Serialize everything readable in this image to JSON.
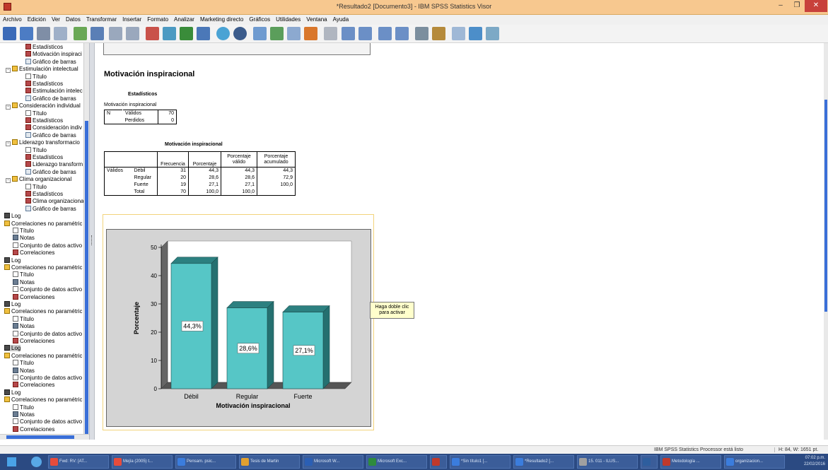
{
  "window": {
    "title": "*Resultado2 [Documento3] - IBM SPSS Statistics Visor"
  },
  "menu": [
    "Archivo",
    "Edición",
    "Ver",
    "Datos",
    "Transformar",
    "Insertar",
    "Formato",
    "Analizar",
    "Marketing directo",
    "Gráficos",
    "Utilidades",
    "Ventana",
    "Ayuda"
  ],
  "outline": [
    {
      "label": "Estadísticos",
      "icon": "statistics-icon",
      "indent": 36
    },
    {
      "label": "Motivación inspiraci",
      "icon": "table-icon",
      "indent": 36
    },
    {
      "label": "Gráfico de barras",
      "icon": "chart-icon",
      "indent": 36
    },
    {
      "label": "Estimulación intelectual",
      "icon": "section-icon",
      "indent": 8,
      "expand": "−"
    },
    {
      "label": "Título",
      "icon": "title-icon",
      "indent": 36
    },
    {
      "label": "Estadísticos",
      "icon": "statistics-icon",
      "indent": 36
    },
    {
      "label": "Estimulación intelec",
      "icon": "table-icon",
      "indent": 36
    },
    {
      "label": "Gráfico de barras",
      "icon": "chart-icon",
      "indent": 36
    },
    {
      "label": "Consideración individual",
      "icon": "section-icon",
      "indent": 8,
      "expand": "−"
    },
    {
      "label": "Título",
      "icon": "title-icon",
      "indent": 36
    },
    {
      "label": "Estadísticos",
      "icon": "statistics-icon",
      "indent": 36
    },
    {
      "label": "Consideración indiv",
      "icon": "table-icon",
      "indent": 36
    },
    {
      "label": "Gráfico de barras",
      "icon": "chart-icon",
      "indent": 36
    },
    {
      "label": "Liderazgo transformacio",
      "icon": "section-icon",
      "indent": 8,
      "expand": "−"
    },
    {
      "label": "Título",
      "icon": "title-icon",
      "indent": 36
    },
    {
      "label": "Estadísticos",
      "icon": "statistics-icon",
      "indent": 36
    },
    {
      "label": "Liderazgo transform",
      "icon": "table-icon",
      "indent": 36
    },
    {
      "label": "Gráfico de barras",
      "icon": "chart-icon",
      "indent": 36
    },
    {
      "label": "Clima organizacional",
      "icon": "section-icon",
      "indent": 8,
      "expand": "−"
    },
    {
      "label": "Título",
      "icon": "title-icon",
      "indent": 36
    },
    {
      "label": "Estadísticos",
      "icon": "statistics-icon",
      "indent": 36
    },
    {
      "label": "Clima organizacional",
      "icon": "table-icon",
      "indent": 36
    },
    {
      "label": "Gráfico de barras",
      "icon": "chart-icon",
      "indent": 36
    },
    {
      "label": "Log",
      "icon": "log-icon",
      "indent": 6
    },
    {
      "label": "Correlaciones no paramétric",
      "icon": "section-icon",
      "indent": 6
    },
    {
      "label": "Título",
      "icon": "title-icon",
      "indent": 18
    },
    {
      "label": "Notas",
      "icon": "notes-icon",
      "indent": 18
    },
    {
      "label": "Conjunto de datos activo",
      "icon": "dataset-icon",
      "indent": 18
    },
    {
      "label": "Correlaciones",
      "icon": "table-icon",
      "indent": 18
    },
    {
      "label": "Log",
      "icon": "log-icon",
      "indent": 6
    },
    {
      "label": "Correlaciones no paramétric",
      "icon": "section-icon",
      "indent": 6
    },
    {
      "label": "Título",
      "icon": "title-icon",
      "indent": 18
    },
    {
      "label": "Notas",
      "icon": "notes-icon",
      "indent": 18
    },
    {
      "label": "Conjunto de datos activo",
      "icon": "dataset-icon",
      "indent": 18
    },
    {
      "label": "Correlaciones",
      "icon": "table-icon",
      "indent": 18
    },
    {
      "label": "Log",
      "icon": "log-icon",
      "indent": 6
    },
    {
      "label": "Correlaciones no paramétric",
      "icon": "section-icon",
      "indent": 6
    },
    {
      "label": "Título",
      "icon": "title-icon",
      "indent": 18
    },
    {
      "label": "Notas",
      "icon": "notes-icon",
      "indent": 18
    },
    {
      "label": "Conjunto de datos activo",
      "icon": "dataset-icon",
      "indent": 18
    },
    {
      "label": "Correlaciones",
      "icon": "table-icon",
      "indent": 18
    },
    {
      "label": "Log",
      "icon": "log-icon",
      "indent": 6,
      "selected": true
    },
    {
      "label": "Correlaciones no paramétric",
      "icon": "section-icon",
      "indent": 6
    },
    {
      "label": "Título",
      "icon": "title-icon",
      "indent": 18
    },
    {
      "label": "Notas",
      "icon": "notes-icon",
      "indent": 18
    },
    {
      "label": "Conjunto de datos activo",
      "icon": "dataset-icon",
      "indent": 18
    },
    {
      "label": "Correlaciones",
      "icon": "table-icon",
      "indent": 18
    },
    {
      "label": "Log",
      "icon": "log-icon",
      "indent": 6
    },
    {
      "label": "Correlaciones no paramétric",
      "icon": "section-icon",
      "indent": 6
    },
    {
      "label": "Título",
      "icon": "title-icon",
      "indent": 18
    },
    {
      "label": "Notas",
      "icon": "notes-icon",
      "indent": 18
    },
    {
      "label": "Conjunto de datos activo",
      "icon": "dataset-icon",
      "indent": 18
    },
    {
      "label": "Correlaciones",
      "icon": "table-icon",
      "indent": 18
    }
  ],
  "content": {
    "heading": "Motivación inspiracional",
    "stats": {
      "title": "Estadísticos",
      "subtitle": "Motivación inspiracional",
      "n_label": "N",
      "valid_label": "Válidos",
      "valid_value": "70",
      "missing_label": "Perdidos",
      "missing_value": "0"
    },
    "freq": {
      "title": "Motivación inspiracional",
      "headers": [
        "Frecuencia",
        "Porcentaje",
        "Porcentaje válido",
        "Porcentaje acumulado"
      ],
      "group_label": "Válidos",
      "rows": [
        {
          "label": "Débil",
          "values": [
            "31",
            "44,3",
            "44,3",
            "44,3"
          ]
        },
        {
          "label": "Regular",
          "values": [
            "20",
            "28,6",
            "28,6",
            "72,9"
          ]
        },
        {
          "label": "Fuerte",
          "values": [
            "19",
            "27,1",
            "27,1",
            "100,0"
          ]
        },
        {
          "label": "Total",
          "values": [
            "70",
            "100,0",
            "100,0",
            ""
          ]
        }
      ]
    },
    "tooltip": "Haga doble clic para activar"
  },
  "chart_data": {
    "type": "bar",
    "categories": [
      "Débil",
      "Regular",
      "Fuerte"
    ],
    "values": [
      44.3,
      28.6,
      27.1
    ],
    "data_labels": [
      "44,3%",
      "28,6%",
      "27,1%"
    ],
    "xlabel": "Motivación inspiracional",
    "ylabel": "Porcentaje",
    "ylim": [
      0,
      50
    ],
    "yticks": [
      "0",
      "10",
      "20",
      "30",
      "40",
      "50"
    ],
    "bar_color": "#56c6c6",
    "background": "#d4d4d4"
  },
  "status": {
    "processor": "IBM SPSS Statistics Processor está listo",
    "size": "H: 84, W: 1651 pt."
  },
  "taskbar": {
    "items": [
      "Fwd: RV: [AT...",
      "Mejía (2005) t...",
      "Pensam. psic...",
      "Tesis de Martin",
      "Microsoft W...",
      "Microsoft Exc...",
      "",
      "*Sin título1 [...",
      "*Resultado2 [...",
      "15. 011 - ILUS...",
      "",
      "Metodología ...",
      "organizacion..."
    ],
    "time": "07:02 p.m.",
    "date": "22/02/2016"
  }
}
